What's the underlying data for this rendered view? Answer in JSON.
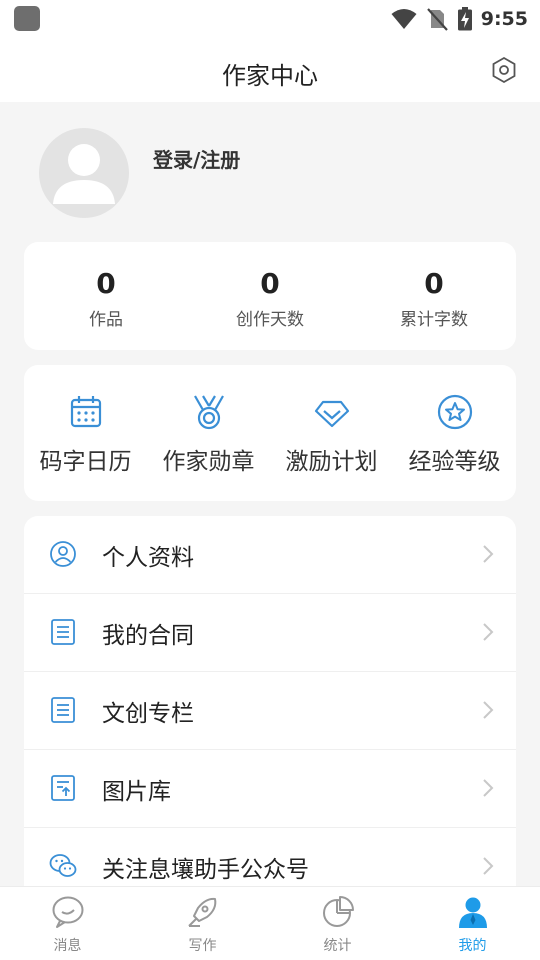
{
  "status_bar": {
    "time": "9:55"
  },
  "header": {
    "title": "作家中心"
  },
  "profile": {
    "login_label": "登录/注册"
  },
  "stats": [
    {
      "value": "0",
      "label": "作品"
    },
    {
      "value": "0",
      "label": "创作天数"
    },
    {
      "value": "0",
      "label": "累计字数"
    }
  ],
  "tools": [
    {
      "label": "码字日历",
      "icon": "calendar-icon"
    },
    {
      "label": "作家勋章",
      "icon": "medal-icon"
    },
    {
      "label": "激励计划",
      "icon": "diamond-icon"
    },
    {
      "label": "经验等级",
      "icon": "star-badge-icon"
    }
  ],
  "menu": [
    {
      "label": "个人资料",
      "icon": "user-circle-icon"
    },
    {
      "label": "我的合同",
      "icon": "document-icon"
    },
    {
      "label": "文创专栏",
      "icon": "document-icon"
    },
    {
      "label": "图片库",
      "icon": "image-upload-icon"
    },
    {
      "label": "关注息壤助手公众号",
      "icon": "wechat-icon"
    }
  ],
  "tabbar": [
    {
      "label": "消息",
      "icon": "message-icon",
      "active": false
    },
    {
      "label": "写作",
      "icon": "pen-icon",
      "active": false
    },
    {
      "label": "统计",
      "icon": "pie-chart-icon",
      "active": false
    },
    {
      "label": "我的",
      "icon": "person-icon",
      "active": true
    }
  ],
  "colors": {
    "accent": "#1e9be8",
    "icon_blue": "#3a8fd6",
    "background": "#f5f5f5"
  }
}
